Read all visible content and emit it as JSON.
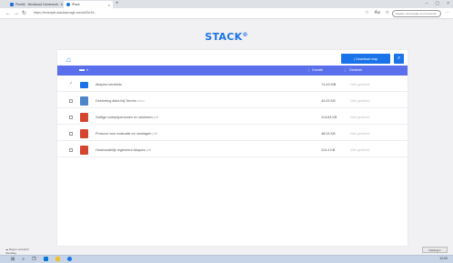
{
  "browser": {
    "tabs": [
      {
        "label": "Pinetik · Nextcloud Homework · A",
        "active": false
      },
      {
        "label": "iPack",
        "active": true
      }
    ],
    "url": "https://example.stackstorage.com/s/f2e15...",
    "search_ext": "Zoeken via Google of url invoeren"
  },
  "app": {
    "logo": "STACK",
    "download_button": "Download map",
    "table": {
      "headers": {
        "size": "Grootte",
        "shared": "Gedeeld"
      },
      "rows": [
        {
          "name": "Akapics kerstfoto",
          "ext": "",
          "size": "74.43 MB",
          "shared": "Niet gedeeld",
          "type": "folder",
          "checked": true
        },
        {
          "name": "Debriefing Alles Mij Terrein",
          "ext": ".docx",
          "size": "43.03 KB",
          "shared": "Niet gedeeld",
          "type": "doc",
          "checked": false
        },
        {
          "name": "Nuttige contactpersonen en adviezen",
          "ext": ".pdf",
          "size": "114.63 KB",
          "shared": "Niet gedeeld",
          "type": "pdf",
          "checked": false
        },
        {
          "name": "Protocol voor evaluatie en verslagen",
          "ext": ".pdf",
          "size": "48.04 KB",
          "shared": "Niet gedeeld",
          "type": "pdf",
          "checked": false
        },
        {
          "name": "Huishoudelijk reglement Akapics",
          "ext": ".pdf",
          "size": "114.4 KB",
          "shared": "Niet gedeeld",
          "type": "pdf",
          "checked": false
        }
      ]
    }
  },
  "os": {
    "weather": "Regen verwacht",
    "weather_sub": "Vandaag",
    "notification": "Meldingen weergeven",
    "clock": "12:00"
  }
}
